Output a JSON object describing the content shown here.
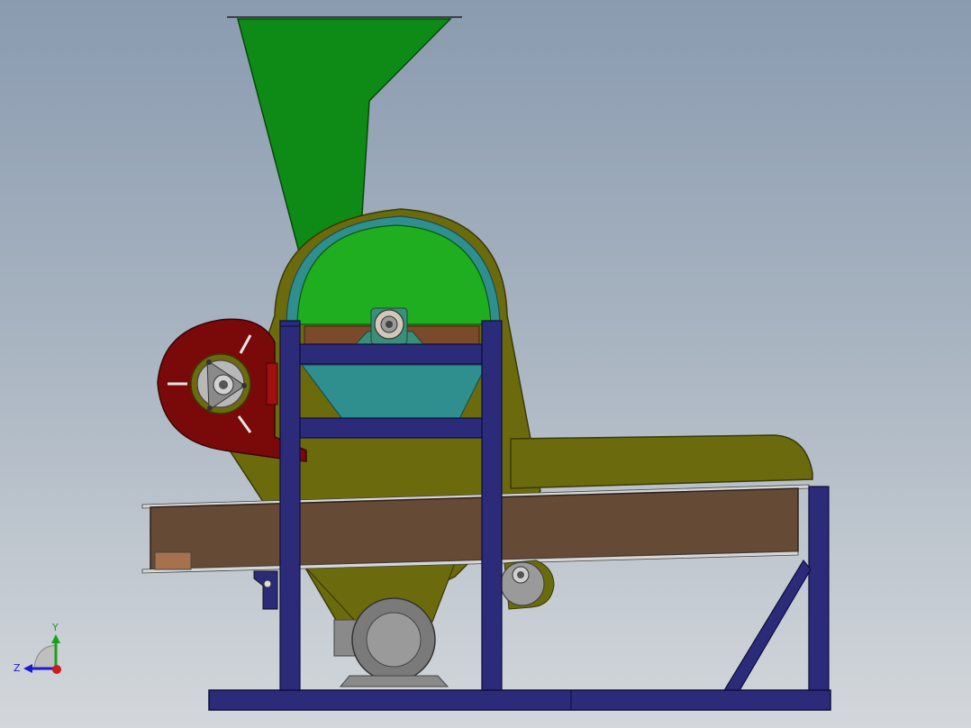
{
  "view": {
    "colors": {
      "background_top": "#8a9bb0",
      "background_bottom": "#d3d7db",
      "hopper": "#0e8a17",
      "rotor_disk": "#1fae1f",
      "housing": "#6b6b0e",
      "housing_inner": "#2f8e8e",
      "fan": "#7a0a0a",
      "frame": "#2b2b7a",
      "conveyor": "#654a36",
      "motor": "#8a8a8a",
      "bearing_block": "#3a8f7a"
    }
  },
  "triad": {
    "x_label": "",
    "y_label": "Y",
    "z_label": "Z",
    "y_color": "#1aa01a",
    "z_color": "#1a1ad0",
    "x_color": "#d01a1a"
  }
}
